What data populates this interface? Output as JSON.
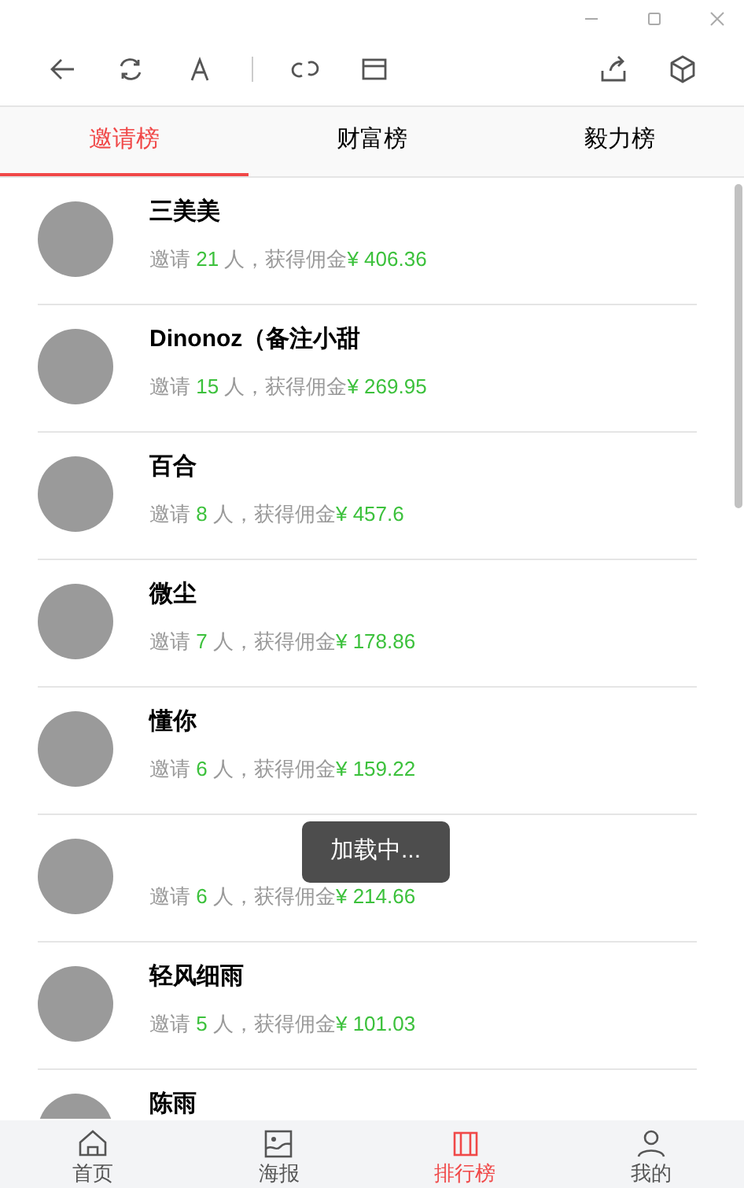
{
  "toolbar": {
    "buttons": [
      {
        "kind": "back"
      },
      {
        "kind": "refresh"
      },
      {
        "kind": "font"
      },
      {
        "kind": "link"
      },
      {
        "kind": "window"
      }
    ],
    "right_buttons": [
      {
        "kind": "share"
      },
      {
        "kind": "cube"
      }
    ]
  },
  "tabs": [
    {
      "label": "邀请榜",
      "selected": true
    },
    {
      "label": "财富榜",
      "selected": false
    },
    {
      "label": "毅力榜",
      "selected": false
    }
  ],
  "rows": [
    {
      "name": "三美美",
      "stats": {
        "prefix": "邀请",
        "count": "21",
        "middle": "人，获得佣金",
        "currency": "¥",
        "amount": "406.36"
      }
    },
    {
      "name": "Dinonoz（备注小甜",
      "stats": {
        "prefix": "邀请",
        "count": "15",
        "middle": "人，获得佣金",
        "currency": "¥",
        "amount": "269.95"
      }
    },
    {
      "name": "百合",
      "stats": {
        "prefix": "邀请",
        "count": "8",
        "middle": "人，获得佣金",
        "currency": "¥",
        "amount": "457.6"
      }
    },
    {
      "name": "微尘",
      "stats": {
        "prefix": "邀请",
        "count": "7",
        "middle": "人，获得佣金",
        "currency": "¥",
        "amount": "178.86"
      }
    },
    {
      "name": "懂你",
      "stats": {
        "prefix": "邀请",
        "count": "6",
        "middle": "人，获得佣金",
        "currency": "¥",
        "amount": "159.22"
      }
    },
    {
      "stats": {
        "prefix": "邀请",
        "count": "6",
        "middle": "人，获得佣金",
        "currency": "¥",
        "amount": "214.66"
      }
    },
    {
      "name": "轻风细雨",
      "stats": {
        "prefix": "邀请",
        "count": "5",
        "middle": "人，获得佣金",
        "currency": "¥",
        "amount": "101.03"
      }
    },
    {
      "name": "陈雨"
    }
  ],
  "toast": {
    "text": "加载中..."
  },
  "bottom_nav": [
    {
      "kind": "home",
      "label": "首页",
      "selected": false
    },
    {
      "kind": "poster",
      "label": "海报",
      "selected": false
    },
    {
      "kind": "rank",
      "label": "排行榜",
      "selected": true
    },
    {
      "kind": "user",
      "label": "我的",
      "selected": false
    }
  ]
}
